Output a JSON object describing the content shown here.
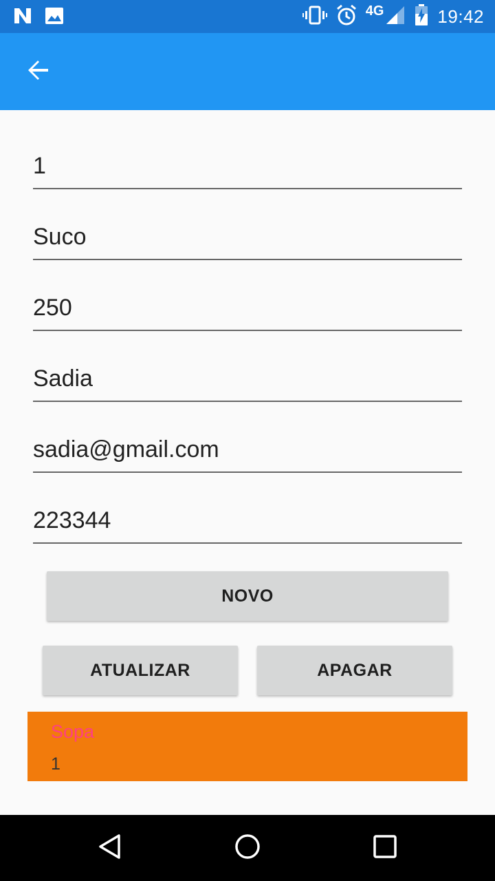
{
  "status_bar": {
    "left_icons": [
      "notification-n-icon",
      "image-icon"
    ],
    "right_icons": [
      "vibrate-icon",
      "alarm-icon",
      "signal-icon",
      "battery-charging-icon"
    ],
    "network": "4G",
    "time": "19:42"
  },
  "app_bar": {
    "back_icon": "arrow-back-icon",
    "color": "#2196f3",
    "status_color": "#1976d2"
  },
  "form": {
    "fields": [
      {
        "value": "1"
      },
      {
        "value": "Suco"
      },
      {
        "value": "250"
      },
      {
        "value": "Sadia"
      },
      {
        "value": "sadia@gmail.com"
      },
      {
        "value": "223344"
      }
    ]
  },
  "buttons": {
    "new_label": "NOVO",
    "update_label": "ATUALIZAR",
    "delete_label": "APAGAR"
  },
  "list": {
    "items": [
      {
        "name": "Sopa",
        "quantity": "1"
      }
    ],
    "item_background": "#f27b0c",
    "name_color": "#ff4081"
  },
  "nav_bar": {
    "icons": [
      "back-triangle-icon",
      "home-circle-icon",
      "recents-square-icon"
    ]
  }
}
